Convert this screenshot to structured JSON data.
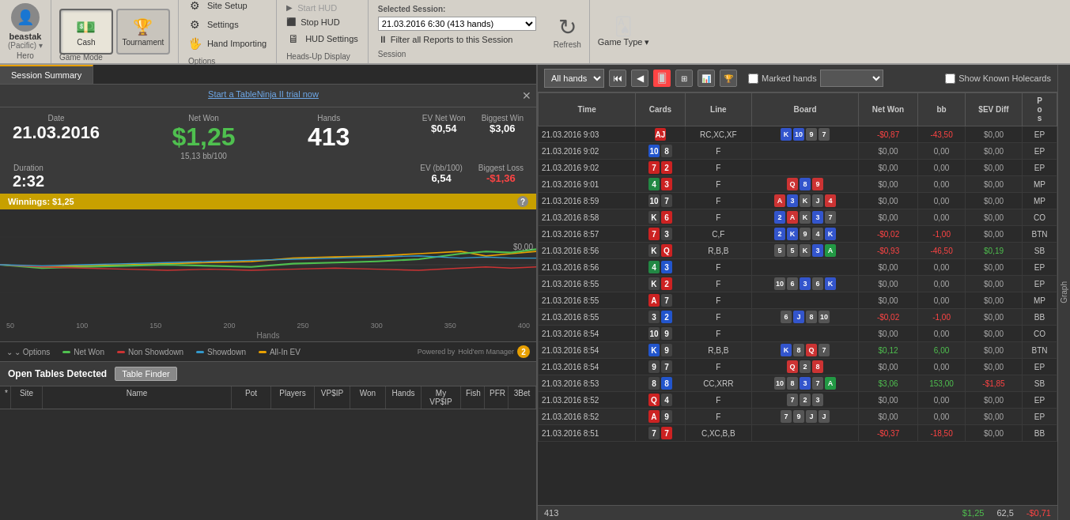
{
  "toolbar": {
    "hero_name": "beastak",
    "hero_sub": "(Pacific) ▾",
    "hero_label": "Hero",
    "cash_label": "Cash",
    "tournament_label": "Tournament",
    "game_mode_label": "Game Mode",
    "site_setup_label": "Site Setup",
    "settings_label": "Settings",
    "hand_importing_label": "Hand Importing",
    "options_label": "Options",
    "start_hud_label": "Start HUD",
    "stop_hud_label": "Stop HUD",
    "hud_settings_label": "HUD Settings",
    "heads_up_display_label": "Heads-Up Display",
    "selected_session_label": "Selected Session:",
    "session_value": "21.03.2016 6:30 (413 hands)",
    "filter_label": "Filter all Reports to this Session",
    "session_label": "Session",
    "refresh_label": "Refresh",
    "game_type_label": "Game Type ▾"
  },
  "session_summary": {
    "tab_label": "Session Summary",
    "trial_text": "Start a TableNinja II trial now",
    "date_label": "Date",
    "date_value": "21.03.2016",
    "net_won_label": "Net Won",
    "net_won_value": "$1,25",
    "net_won_sub": "15,13 bb/100",
    "hands_label": "Hands",
    "hands_value": "413",
    "duration_label": "Duration",
    "duration_value": "2:32",
    "ev_net_won_label": "EV Net Won",
    "ev_net_won_value": "$0,54",
    "biggest_win_label": "Biggest Win",
    "biggest_win_value": "$3,06",
    "ev_bb100_label": "EV (bb/100)",
    "ev_bb100_value": "6,54",
    "biggest_loss_label": "Biggest Loss",
    "biggest_loss_value": "-$1,36",
    "winnings_label": "Winnings: $1,25",
    "chart_x_labels": [
      "50",
      "100",
      "150",
      "200",
      "250",
      "300",
      "350",
      "400"
    ],
    "chart_x_title": "Hands",
    "chart_y_value": "$0,00",
    "legend_net_won": "Net Won",
    "legend_non_showdown": "Non Showdown",
    "legend_showdown": "Showdown",
    "legend_allin_ev": "All-In EV",
    "options_label": "⌄ Options",
    "powered_by": "Powered by",
    "hm_label": "Hold'em Manager",
    "hm_version": "2"
  },
  "open_tables": {
    "header": "Open Tables Detected",
    "finder_btn": "Table Finder",
    "columns": {
      "star": "*",
      "site": "Site",
      "name": "Name",
      "pot": "Pot",
      "players": "Players",
      "vpip": "VP$IP",
      "won": "Won",
      "hands": "Hands",
      "my_vpip": "My VP$IP",
      "fish": "Fish",
      "pfr": "PFR",
      "three_bet": "3Bet"
    }
  },
  "hands_panel": {
    "filter_label": "All hands",
    "marked_label": "Marked hands",
    "holecards_label": "Show Known Holecards",
    "graph_label": "Graph",
    "columns": {
      "time": "Time",
      "cards": "Cards",
      "line": "Line",
      "board": "Board",
      "net_won": "Net Won",
      "bb": "bb",
      "sev_diff": "$EV Diff",
      "pos": "P o s"
    },
    "hands": [
      {
        "time": "21.03.2016 9:03",
        "cards": [
          "AJ"
        ],
        "cards_colors": [
          "red",
          "blue"
        ],
        "line": "RC,XC,XF",
        "board": [
          "K",
          "10",
          "9",
          "7"
        ],
        "board_colors": [
          "blue",
          "blue",
          "dark",
          "dark"
        ],
        "net_won": "-$0,87",
        "bb": "-43,50",
        "sev": "$0,00",
        "pos": "EP",
        "net_class": "neg"
      },
      {
        "time": "21.03.2016 9:02",
        "cards": [
          "10",
          "8"
        ],
        "cards_colors": [
          "blue",
          "dark"
        ],
        "line": "F",
        "board": [],
        "net_won": "$0,00",
        "bb": "0,00",
        "sev": "$0,00",
        "pos": "EP",
        "net_class": "zero"
      },
      {
        "time": "21.03.2016 9:02",
        "cards": [
          "7",
          "2"
        ],
        "cards_colors": [
          "red",
          "red"
        ],
        "line": "F",
        "board": [],
        "net_won": "$0,00",
        "bb": "0,00",
        "sev": "$0,00",
        "pos": "EP",
        "net_class": "zero"
      },
      {
        "time": "21.03.2016 9:01",
        "cards": [
          "4",
          "3"
        ],
        "cards_colors": [
          "green",
          "red"
        ],
        "line": "F",
        "board": [
          "Q",
          "8",
          "9"
        ],
        "board_colors": [
          "red",
          "blue",
          "red"
        ],
        "net_won": "$0,00",
        "bb": "0,00",
        "sev": "$0,00",
        "pos": "MP",
        "net_class": "zero"
      },
      {
        "time": "21.03.2016 8:59",
        "cards": [
          "10",
          "7"
        ],
        "cards_colors": [
          "dark",
          "dark"
        ],
        "line": "F",
        "board": [
          "A",
          "3",
          "K",
          "J",
          "4"
        ],
        "board_colors": [
          "red",
          "blue",
          "dark",
          "dark",
          "red"
        ],
        "net_won": "$0,00",
        "bb": "0,00",
        "sev": "$0,00",
        "pos": "MP",
        "net_class": "zero"
      },
      {
        "time": "21.03.2016 8:58",
        "cards": [
          "K",
          "6"
        ],
        "cards_colors": [
          "dark",
          "red"
        ],
        "line": "F",
        "board": [
          "2",
          "A",
          "K",
          "3",
          "7"
        ],
        "board_colors": [
          "blue",
          "red",
          "dark",
          "blue",
          "dark"
        ],
        "net_won": "$0,00",
        "bb": "0,00",
        "sev": "$0,00",
        "pos": "CO",
        "net_class": "zero"
      },
      {
        "time": "21.03.2016 8:57",
        "cards": [
          "7",
          "3"
        ],
        "cards_colors": [
          "red",
          "dark"
        ],
        "line": "C,F",
        "board": [
          "2",
          "K",
          "9",
          "4",
          "K"
        ],
        "board_colors": [
          "blue",
          "blue",
          "dark",
          "dark",
          "blue"
        ],
        "net_won": "-$0,02",
        "bb": "-1,00",
        "sev": "$0,00",
        "pos": "BTN",
        "net_class": "neg"
      },
      {
        "time": "21.03.2016 8:56",
        "cards": [
          "K",
          "Q"
        ],
        "cards_colors": [
          "dark",
          "red"
        ],
        "line": "R,B,B",
        "board": [
          "5",
          "5",
          "K",
          "3",
          "A"
        ],
        "board_colors": [
          "dark",
          "dark",
          "dark",
          "blue",
          "green"
        ],
        "net_won": "-$0,93",
        "bb": "-46,50",
        "sev": "$0,19",
        "pos": "SB",
        "net_class": "neg"
      },
      {
        "time": "21.03.2016 8:56",
        "cards": [
          "4",
          "3"
        ],
        "cards_colors": [
          "green",
          "blue"
        ],
        "line": "F",
        "board": [],
        "net_won": "$0,00",
        "bb": "0,00",
        "sev": "$0,00",
        "pos": "EP",
        "net_class": "zero"
      },
      {
        "time": "21.03.2016 8:55",
        "cards": [
          "K",
          "2"
        ],
        "cards_colors": [
          "dark",
          "red"
        ],
        "line": "F",
        "board": [
          "10",
          "6",
          "3",
          "6",
          "K"
        ],
        "board_colors": [
          "dark",
          "dark",
          "blue",
          "dark",
          "blue"
        ],
        "net_won": "$0,00",
        "bb": "0,00",
        "sev": "$0,00",
        "pos": "EP",
        "net_class": "zero"
      },
      {
        "time": "21.03.2016 8:55",
        "cards": [
          "A",
          "7"
        ],
        "cards_colors": [
          "red",
          "dark"
        ],
        "line": "F",
        "board": [],
        "net_won": "$0,00",
        "bb": "0,00",
        "sev": "$0,00",
        "pos": "MP",
        "net_class": "zero"
      },
      {
        "time": "21.03.2016 8:55",
        "cards": [
          "3",
          "2"
        ],
        "cards_colors": [
          "dark",
          "blue"
        ],
        "line": "F",
        "board": [
          "6",
          "J",
          "8",
          "10"
        ],
        "board_colors": [
          "dark",
          "blue",
          "dark",
          "dark"
        ],
        "net_won": "-$0,02",
        "bb": "-1,00",
        "sev": "$0,00",
        "pos": "BB",
        "net_class": "neg"
      },
      {
        "time": "21.03.2016 8:54",
        "cards": [
          "10",
          "9"
        ],
        "cards_colors": [
          "dark",
          "dark"
        ],
        "line": "F",
        "board": [],
        "net_won": "$0,00",
        "bb": "0,00",
        "sev": "$0,00",
        "pos": "CO",
        "net_class": "zero"
      },
      {
        "time": "21.03.2016 8:54",
        "cards": [
          "K",
          "9"
        ],
        "cards_colors": [
          "blue",
          "dark"
        ],
        "line": "R,B,B",
        "board": [
          "K",
          "8",
          "Q",
          "7"
        ],
        "board_colors": [
          "blue",
          "dark",
          "red",
          "dark"
        ],
        "net_won": "$0,12",
        "bb": "6,00",
        "sev": "$0,00",
        "pos": "BTN",
        "net_class": "pos"
      },
      {
        "time": "21.03.2016 8:54",
        "cards": [
          "9",
          "7"
        ],
        "cards_colors": [
          "dark",
          "dark"
        ],
        "line": "F",
        "board": [
          "Q",
          "2",
          "8"
        ],
        "board_colors": [
          "red",
          "dark",
          "red"
        ],
        "net_won": "$0,00",
        "bb": "0,00",
        "sev": "$0,00",
        "pos": "EP",
        "net_class": "zero"
      },
      {
        "time": "21.03.2016 8:53",
        "cards": [
          "8",
          "8"
        ],
        "cards_colors": [
          "dark",
          "blue"
        ],
        "line": "CC,XRR",
        "board": [
          "10",
          "8",
          "3",
          "7",
          "A"
        ],
        "board_colors": [
          "dark",
          "dark",
          "blue",
          "dark",
          "green"
        ],
        "net_won": "$3,06",
        "bb": "153,00",
        "sev": "-$1,85",
        "pos": "SB",
        "net_class": "pos"
      },
      {
        "time": "21.03.2016 8:52",
        "cards": [
          "Q",
          "4"
        ],
        "cards_colors": [
          "red",
          "dark"
        ],
        "line": "F",
        "board": [
          "7",
          "2",
          "3"
        ],
        "board_colors": [
          "dark",
          "dark",
          "dark"
        ],
        "net_won": "$0,00",
        "bb": "0,00",
        "sev": "$0,00",
        "pos": "EP",
        "net_class": "zero"
      },
      {
        "time": "21.03.2016 8:52",
        "cards": [
          "A",
          "9"
        ],
        "cards_colors": [
          "red",
          "dark"
        ],
        "line": "F",
        "board": [
          "7",
          "9",
          "J",
          "J"
        ],
        "board_colors": [
          "dark",
          "dark",
          "dark",
          "dark"
        ],
        "net_won": "$0,00",
        "bb": "0,00",
        "sev": "$0,00",
        "pos": "EP",
        "net_class": "zero"
      },
      {
        "time": "21.03.2016 8:51",
        "cards": [
          "7",
          "7"
        ],
        "cards_colors": [
          "dark",
          "red"
        ],
        "line": "C,XC,B,B",
        "board": [],
        "net_won": "-$0,37",
        "bb": "-18,50",
        "sev": "$0,00",
        "pos": "BB",
        "net_class": "neg"
      }
    ],
    "footer_count": "413",
    "footer_net": "$1,25",
    "footer_bb": "62,5",
    "footer_sev": "-$0,71"
  }
}
